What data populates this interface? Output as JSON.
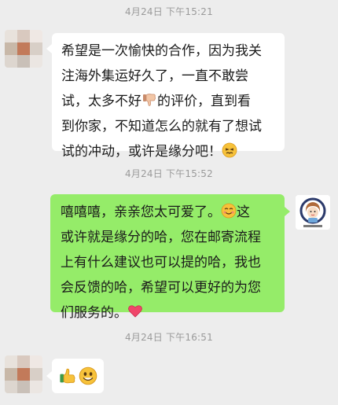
{
  "chat": {
    "timestamps": [
      "4月24日 下午15:21",
      "4月24日 下午15:52",
      "4月24日 下午16:51"
    ],
    "message1": {
      "line1": "希望是一次愉快的合作，因为我关",
      "line2": "注海外集运好久了，一直不敢尝",
      "line3a": "试，太多不好",
      "line3b": "的评价，直到看",
      "line4": "到你家，不知道怎么的就有了想试",
      "line5": "试的冲动，或许是缘分吧！",
      "emojis": [
        "thumbs-down-icon",
        "embarrassed-face-icon"
      ]
    },
    "message2": {
      "line1a": "嘻嘻嘻，亲亲您太可爱了。",
      "line1b": "这",
      "line2": "或许就是缘分的哈，您在邮寄流程",
      "line3": "上有什么建议也可以提的哈，我也",
      "line4": "会反馈的哈，希望可以更好的为您",
      "line5": "们服务的。",
      "emojis": [
        "smiling-face-icon",
        "red-heart-icon"
      ]
    },
    "message3": {
      "emojis": [
        "thumbs-up-icon",
        "smiling-face-icon"
      ]
    },
    "colors": {
      "background": "#ededed",
      "received_bubble": "#ffffff",
      "sent_bubble": "#95ec69",
      "timestamp": "#9a9a9a"
    }
  }
}
